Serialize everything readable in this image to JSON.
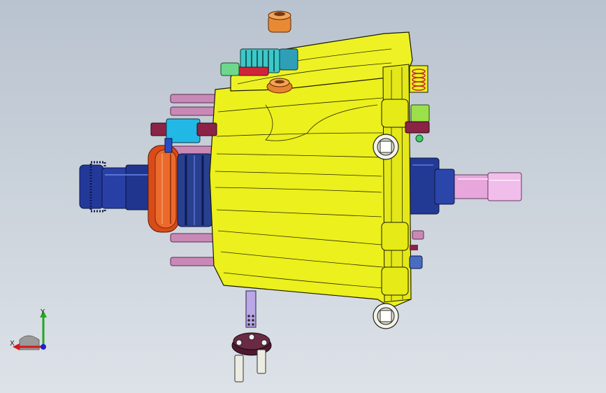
{
  "viewport": {
    "background_top": "#b9c3cf",
    "background_bottom": "#dde2e8"
  },
  "triad": {
    "x_label": "X",
    "y_label": "Y",
    "x_color": "#d41818",
    "y_color": "#22a822",
    "z_color": "#2020d0"
  },
  "part_colors": {
    "housing": "#ecf01c",
    "flange": "#e0521c",
    "hub": "#243a96",
    "shaft": "#eeb0e4",
    "studs": "#c989b6",
    "cyan_part": "#24c8ec",
    "green_part": "#8fd94a",
    "orange_cap": "#e88a35",
    "plug": "#4e1a30"
  }
}
